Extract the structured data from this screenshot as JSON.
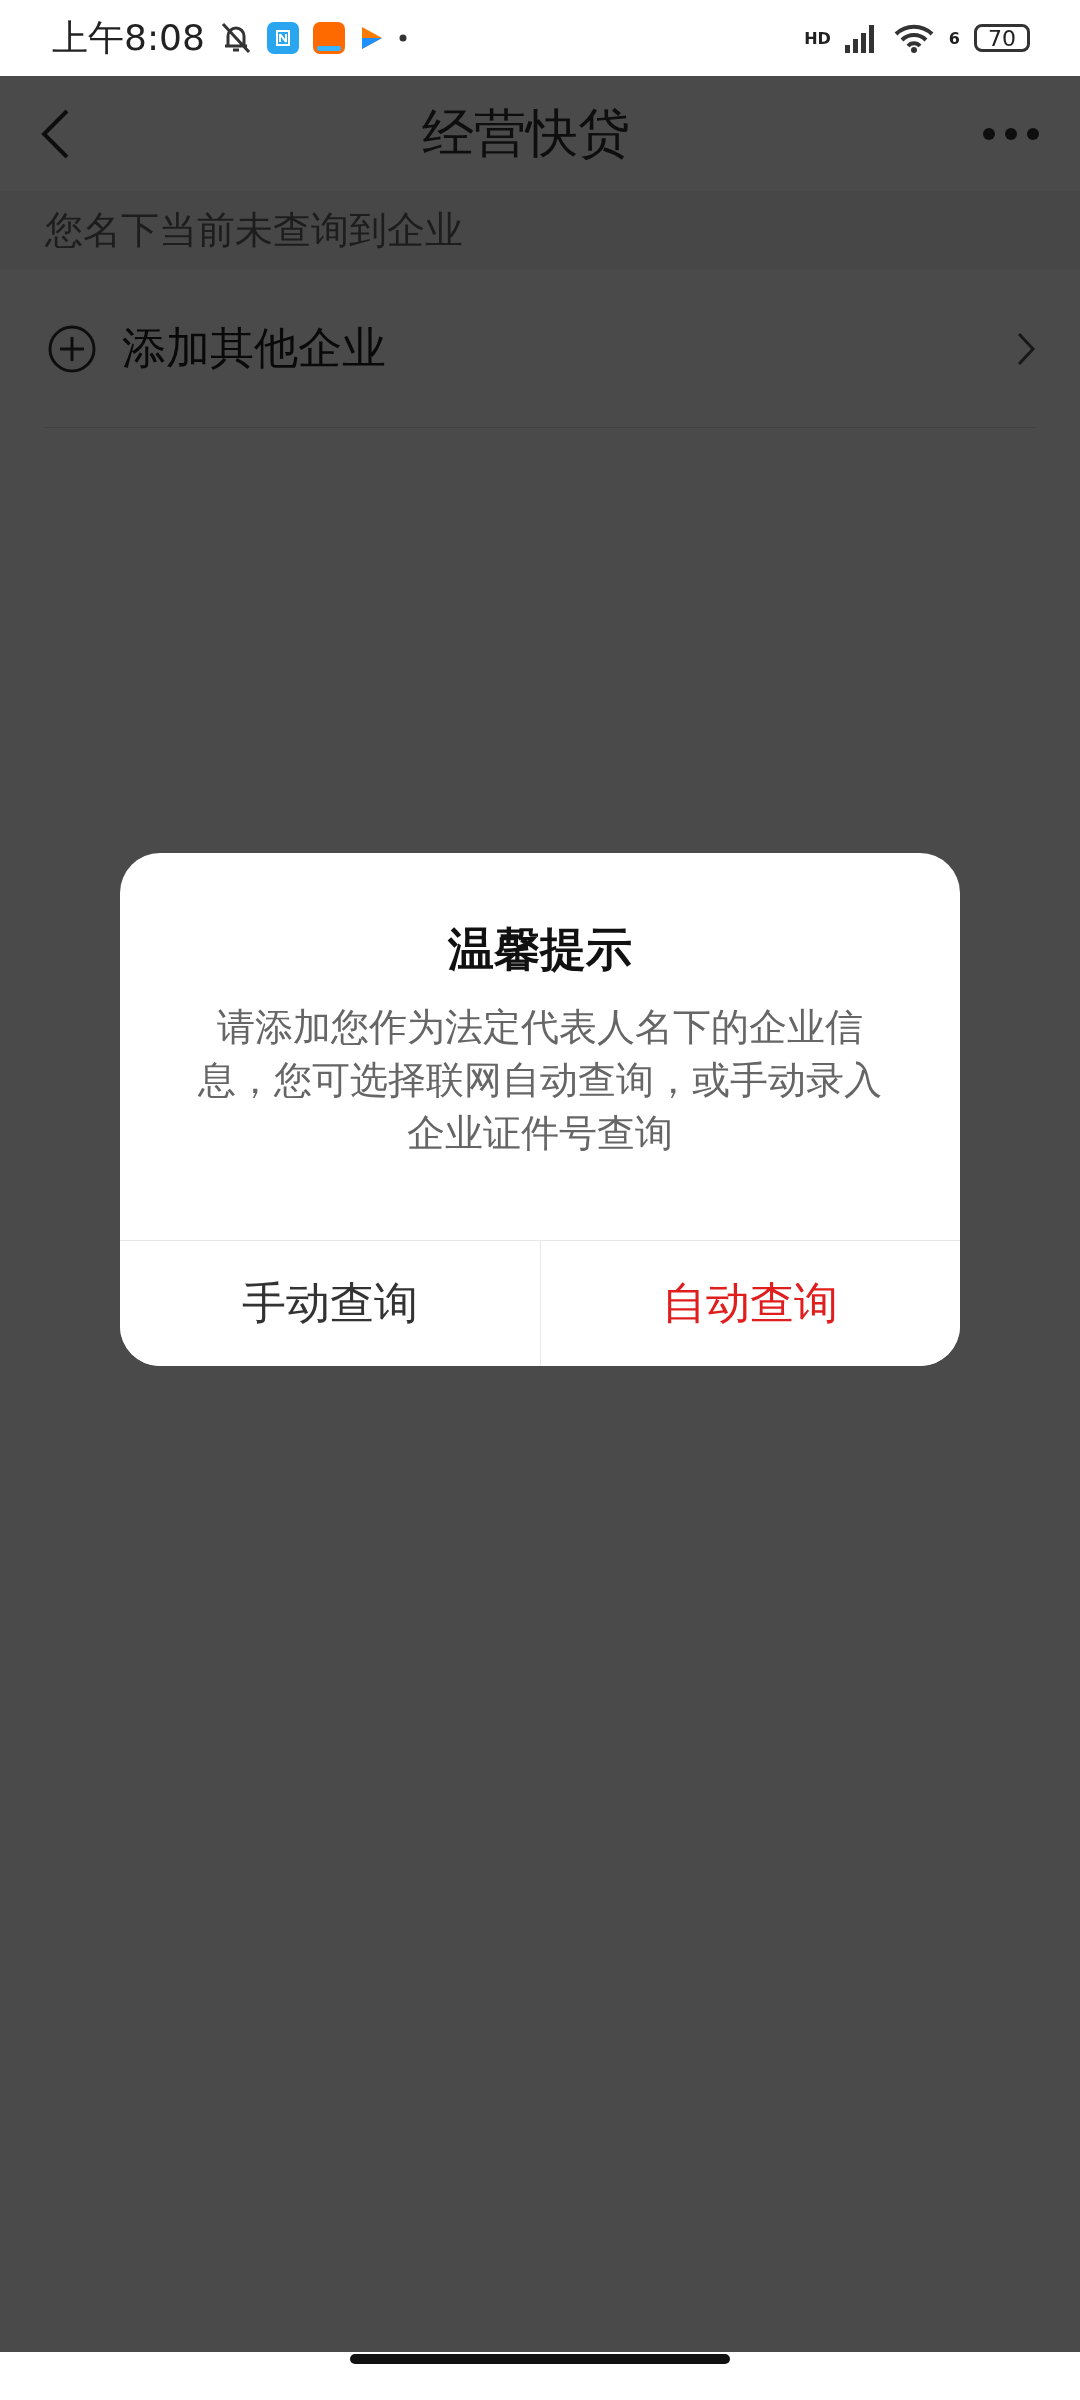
{
  "status_bar": {
    "time": "上午8:08",
    "signal_label": "HD",
    "wifi_label": "6",
    "battery": "70"
  },
  "nav": {
    "title": "经营快贷"
  },
  "notice": "您名下当前未查询到企业",
  "add_row": {
    "label": "添加其他企业"
  },
  "dialog": {
    "title": "温馨提示",
    "message": "请添加您作为法定代表人名下的企业信息，您可选择联网自动查询，或手动录入企业证件号查询",
    "buttons": [
      {
        "label": "手动查询",
        "primary": false
      },
      {
        "label": "自动查询",
        "primary": true
      }
    ]
  }
}
